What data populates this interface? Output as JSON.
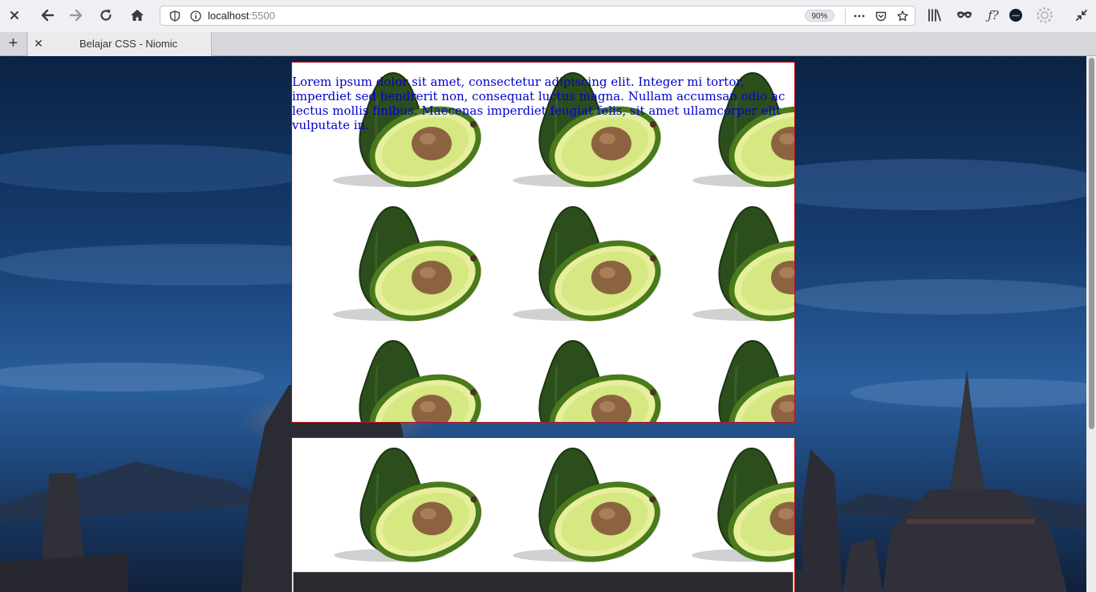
{
  "browser": {
    "url_host": "localhost",
    "url_port": ":5500",
    "zoom": "90%"
  },
  "tabs": [
    {
      "title": "Belajar CSS - Niomic"
    }
  ],
  "page": {
    "paragraph": "Lorem ipsum dolor sit amet, consectetur adipiscing elit. Integer mi tortor, imperdiet sed hendrerit non, consequat luctus magna. Nullam accumsan odio ac lectus mollis finibus. Maecenas imperdiet feugiat felis, sit amet ullamcorper elit vulputate in."
  },
  "colors": {
    "box_border": "#c0101a",
    "paragraph_text": "#0000cc",
    "sky_top": "#0b2244",
    "sky_mid": "#1e4f8f"
  },
  "icons": {
    "close": "close-icon",
    "back": "back-arrow-icon",
    "forward": "forward-arrow-icon",
    "reload": "reload-icon",
    "home": "home-icon",
    "shield": "shield-icon",
    "info": "info-icon",
    "more": "more-icon",
    "pocket": "pocket-icon",
    "bookmark": "star-icon",
    "library": "library-icon",
    "private": "mask-icon",
    "function": "function-icon",
    "account": "account-icon",
    "settings": "gear-icon",
    "collapse": "collapse-icon",
    "new_tab": "plus-icon",
    "tab_close": "close-icon",
    "tile": "avocado-image"
  }
}
